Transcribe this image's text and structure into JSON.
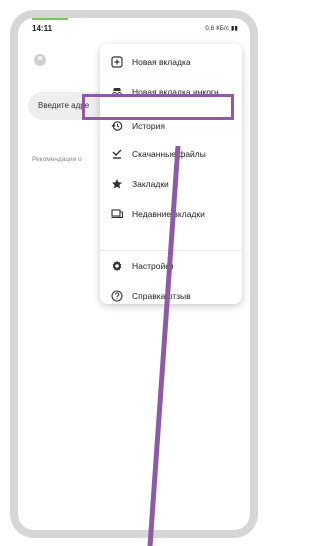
{
  "status_bar": {
    "time": "14:11",
    "network": "0,8 КБ/с"
  },
  "page": {
    "search_placeholder": "Введите адре",
    "recommendations": "Рекомендации о"
  },
  "menu": {
    "items": [
      {
        "label": "Новая вкладка",
        "icon": "new-tab-icon"
      },
      {
        "label": "Новая вкладка инкогн...",
        "icon": "incognito-icon"
      },
      {
        "label": "История",
        "icon": "history-icon"
      },
      {
        "label": "Скачанные файлы",
        "icon": "download-icon"
      },
      {
        "label": "Закладки",
        "icon": "star-icon"
      },
      {
        "label": "Недавние вкладки",
        "icon": "devices-icon"
      },
      {
        "label": "Настройки",
        "icon": "gear-icon"
      },
      {
        "label": "Справка/отзыв",
        "icon": "help-icon"
      }
    ],
    "highlighted_item": "История"
  },
  "colors": {
    "highlight": "#8e5aa8",
    "status_accent": "#7cc35a"
  }
}
